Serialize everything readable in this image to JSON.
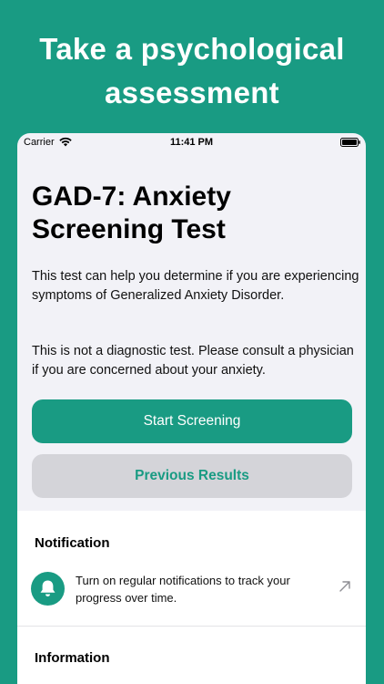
{
  "promo": {
    "title": "Take a psychological assessment"
  },
  "status_bar": {
    "carrier": "Carrier",
    "time": "11:41 PM"
  },
  "screen": {
    "title": "GAD-7: Anxiety Screening Test",
    "description_1": "This test can help you determine if you are experiencing symptoms of Generalized Anxiety Disorder.",
    "description_2": "This is not a diagnostic test. Please consult a physician if you are concerned about your anxiety.",
    "start_button": "Start Screening",
    "previous_button": "Previous Results"
  },
  "notification_section": {
    "header": "Notification",
    "text": "Turn on regular notifications to track your progress over time.",
    "icon": "bell-icon"
  },
  "information_section": {
    "header": "Information"
  },
  "colors": {
    "accent": "#199b83",
    "background": "#f2f2f7",
    "secondary_button": "#d4d4d9"
  }
}
